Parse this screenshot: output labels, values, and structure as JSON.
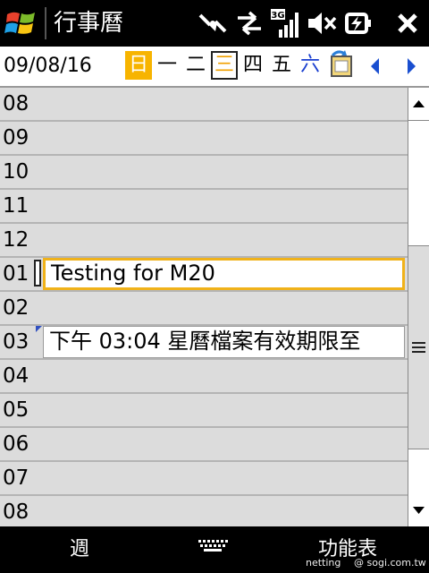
{
  "titlebar": {
    "app_title": "行事曆"
  },
  "date_row": {
    "date": "09/08/16",
    "weekdays": [
      "日",
      "一",
      "二",
      "三",
      "四",
      "五",
      "六"
    ]
  },
  "schedule": {
    "hours": [
      "08",
      "09",
      "10",
      "11",
      "12",
      "01",
      "02",
      "03",
      "04",
      "05",
      "06",
      "07",
      "08"
    ],
    "appointments": [
      {
        "hour_index": 5,
        "text": "Testing for M20",
        "selected": true
      },
      {
        "hour_index": 7,
        "text": "下午 03:04 星曆檔案有效期限至",
        "selected": false
      }
    ]
  },
  "softkeys": {
    "left": "週",
    "right": "功能表"
  },
  "watermark": {
    "left": "netting",
    "right": "@ sogi.com.tw"
  },
  "colors": {
    "accent": "#f7b400",
    "saturday": "#1a3fd0",
    "grid": "#dcdcdc"
  },
  "icons": [
    "windows-start-icon",
    "connectivity-icon",
    "sync-arrows-icon",
    "signal-3g-icon",
    "volume-muted-icon",
    "battery-charging-icon",
    "close-icon",
    "today-icon",
    "prev-arrow-icon",
    "next-arrow-icon",
    "keyboard-icon"
  ]
}
